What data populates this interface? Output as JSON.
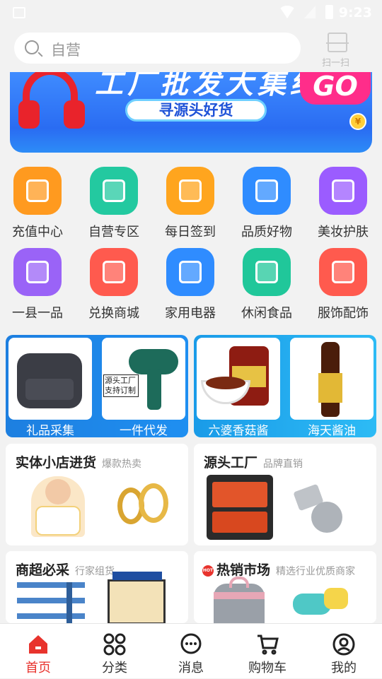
{
  "status_bar": {
    "time": "9:23"
  },
  "search": {
    "placeholder": "自营",
    "scan_label": "扫一扫"
  },
  "banner": {
    "headline": "工厂批发大集结",
    "pill": "寻源头好货",
    "go": "GO",
    "coin": "¥"
  },
  "categories": [
    {
      "label": "充值中心",
      "icon": "phone-topup-icon",
      "color": "#ff9a1f"
    },
    {
      "label": "自营专区",
      "icon": "shopping-bag-icon",
      "color": "#23c9a0"
    },
    {
      "label": "每日签到",
      "icon": "calendar-check-icon",
      "color": "#ffa51e"
    },
    {
      "label": "品质好物",
      "icon": "bag-icon",
      "color": "#2f8cff"
    },
    {
      "label": "美妆护肤",
      "icon": "makeup-icon",
      "color": "#9b5cff"
    },
    {
      "label": "一县一品",
      "icon": "store-icon",
      "color": "#9a63f7"
    },
    {
      "label": "兑换商城",
      "icon": "gift-icon",
      "color": "#ff5a4e"
    },
    {
      "label": "家用电器",
      "icon": "fridge-icon",
      "color": "#2f8cff"
    },
    {
      "label": "休闲食品",
      "icon": "candy-icon",
      "color": "#20c79a"
    },
    {
      "label": "服饰配饰",
      "icon": "tshirt-icon",
      "color": "#ff5a4e"
    }
  ],
  "tiles": [
    {
      "label": "礼品采集"
    },
    {
      "label": "一件代发",
      "tag": "源头工厂支持订制"
    },
    {
      "label": "六婆香菇酱"
    },
    {
      "label": "海天酱油"
    }
  ],
  "cards": [
    {
      "title": "实体小店进货",
      "sub": "爆款热卖"
    },
    {
      "title": "源头工厂",
      "sub": "品牌直销"
    },
    {
      "title": "商超必采",
      "sub": "行家组货"
    },
    {
      "title": "热销市场",
      "sub": "精选行业优质商家",
      "badge": "HOT"
    }
  ],
  "tabbar": [
    {
      "label": "首页",
      "icon": "home-icon",
      "active": true
    },
    {
      "label": "分类",
      "icon": "category-grid-icon",
      "active": false
    },
    {
      "label": "消息",
      "icon": "message-icon",
      "active": false
    },
    {
      "label": "购物车",
      "icon": "cart-icon",
      "active": false
    },
    {
      "label": "我的",
      "icon": "profile-icon",
      "active": false
    }
  ],
  "colors": {
    "accent": "#e8332d",
    "tile_blue": "#1d7fe0",
    "tile_cyan": "#1a9be8"
  }
}
